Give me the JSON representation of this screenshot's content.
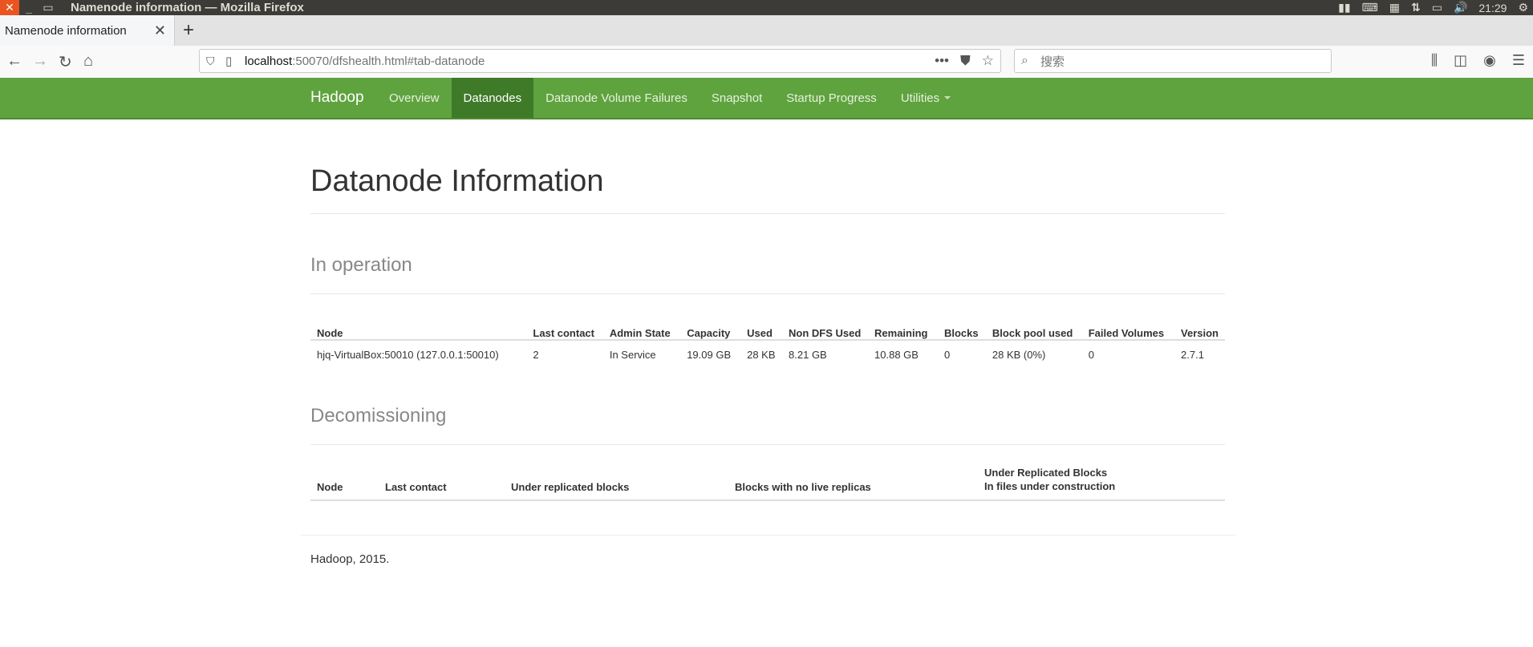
{
  "os": {
    "window_title": "Namenode information — Mozilla Firefox",
    "clock": "21:29"
  },
  "browser": {
    "tab_title": "Namenode information",
    "url_host": "localhost",
    "url_rest": ":50070/dfshealth.html#tab-datanode",
    "search_placeholder": "搜索"
  },
  "hadoop_nav": {
    "brand": "Hadoop",
    "items": [
      {
        "label": "Overview"
      },
      {
        "label": "Datanodes"
      },
      {
        "label": "Datanode Volume Failures"
      },
      {
        "label": "Snapshot"
      },
      {
        "label": "Startup Progress"
      },
      {
        "label": "Utilities"
      }
    ]
  },
  "page": {
    "title": "Datanode Information",
    "in_operation": {
      "title": "In operation",
      "headers": [
        "Node",
        "Last contact",
        "Admin State",
        "Capacity",
        "Used",
        "Non DFS Used",
        "Remaining",
        "Blocks",
        "Block pool used",
        "Failed Volumes",
        "Version"
      ],
      "rows": [
        [
          "hjq-VirtualBox:50010 (127.0.0.1:50010)",
          "2",
          "In Service",
          "19.09 GB",
          "28 KB",
          "8.21 GB",
          "10.88 GB",
          "0",
          "28 KB (0%)",
          "0",
          "2.7.1"
        ]
      ]
    },
    "decommissioning": {
      "title": "Decomissioning",
      "headers": [
        "Node",
        "Last contact",
        "Under replicated blocks",
        "Blocks with no live replicas"
      ],
      "last_header_line1": "Under Replicated Blocks",
      "last_header_line2": "In files under construction"
    }
  },
  "footer": {
    "text": "Hadoop, 2015."
  }
}
